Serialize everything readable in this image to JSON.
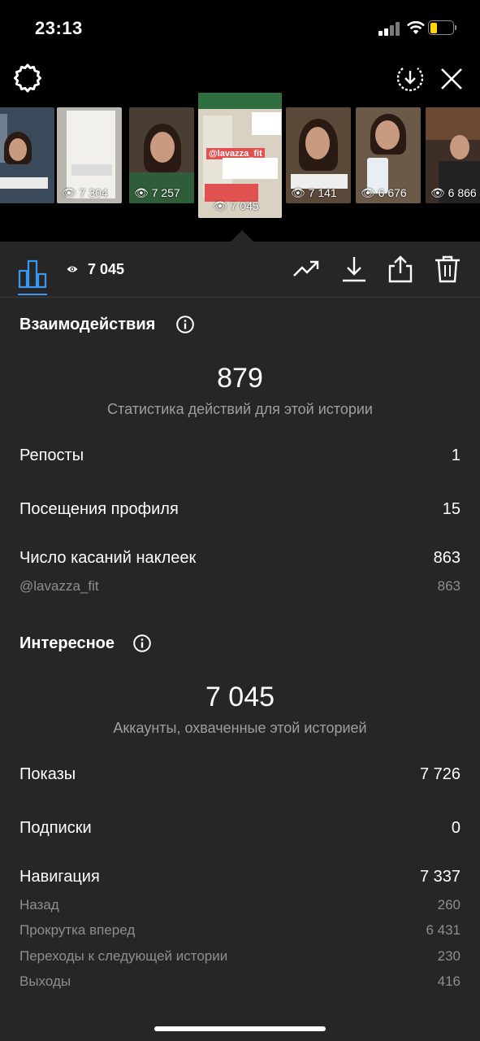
{
  "status": {
    "time": "23:13"
  },
  "thumbs": [
    {
      "views": ""
    },
    {
      "views": "7 304"
    },
    {
      "views": "7 257"
    },
    {
      "views": "7 045",
      "sticker": "@lavazza_fit"
    },
    {
      "views": "7 141"
    },
    {
      "views": "6 676"
    },
    {
      "views": "6 866"
    }
  ],
  "toolbar": {
    "views": "7 045"
  },
  "interactions": {
    "title": "Взаимодействия",
    "total": "879",
    "caption": "Статистика действий для этой истории",
    "rows": [
      {
        "label": "Репосты",
        "value": "1"
      },
      {
        "label": "Посещения профиля",
        "value": "15"
      },
      {
        "label": "Число касаний наклеек",
        "value": "863"
      }
    ],
    "sub": {
      "label": "@lavazza_fit",
      "value": "863"
    }
  },
  "discovery": {
    "title": "Интересное",
    "total": "7 045",
    "caption": "Аккаунты, охваченные этой историей",
    "rows": [
      {
        "label": "Показы",
        "value": "7 726"
      },
      {
        "label": "Подписки",
        "value": "0"
      },
      {
        "label": "Навигация",
        "value": "7 337"
      }
    ],
    "nav": [
      {
        "label": "Назад",
        "value": "260"
      },
      {
        "label": "Прокрутка вперед",
        "value": "6 431"
      },
      {
        "label": "Переходы к следующей истории",
        "value": "230"
      },
      {
        "label": "Выходы",
        "value": "416"
      }
    ]
  },
  "colors": {
    "accent": "#3897f0",
    "panel": "#262626",
    "muted": "#8e8e8e"
  }
}
